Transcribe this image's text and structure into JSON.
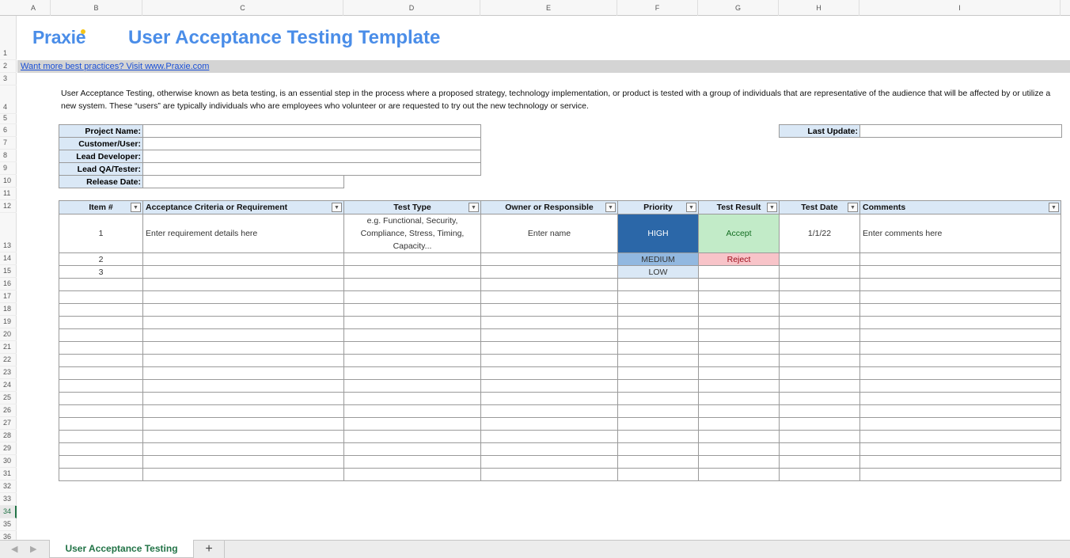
{
  "columns": [
    "A",
    "B",
    "C",
    "D",
    "E",
    "F",
    "G",
    "H",
    "I"
  ],
  "rows": [
    "1",
    "2",
    "3",
    "4",
    "5",
    "6",
    "7",
    "8",
    "9",
    "10",
    "11",
    "12",
    "13",
    "14",
    "15",
    "16",
    "17",
    "18",
    "19",
    "20",
    "21",
    "22",
    "23",
    "24",
    "25",
    "26",
    "27",
    "28",
    "29",
    "30",
    "31",
    "32",
    "33",
    "34",
    "35",
    "36"
  ],
  "active_row": "34",
  "header": {
    "logo": "Praxie",
    "title": "User Acceptance Testing Template",
    "link": "Want more best practices? Visit www.Praxie.com "
  },
  "description": "User Acceptance Testing, otherwise known as beta testing, is an essential step in the process where a proposed strategy, technology implementation, or product is tested with a group of individuals that are representative of the audience that will be affected by or utilize a new system. These “users” are typically individuals who are employees who volunteer or are requested to try out the new technology or service.",
  "project_info": {
    "project_name": {
      "label": "Project Name:",
      "value": ""
    },
    "customer_user": {
      "label": "Customer/User:",
      "value": ""
    },
    "lead_developer": {
      "label": "Lead Developer:",
      "value": ""
    },
    "lead_qa": {
      "label": "Lead QA/Tester:",
      "value": ""
    },
    "release_date": {
      "label": "Release Date:",
      "value": ""
    },
    "last_update": {
      "label": "Last Update:",
      "value": ""
    }
  },
  "table": {
    "headers": [
      "Item #",
      "Acceptance Criteria or Requirement",
      "Test Type",
      "Owner or Responsible",
      "Priority",
      "Test Result",
      "Test Date",
      "Comments"
    ],
    "rows": [
      [
        "1",
        "Enter requirement details here",
        "e.g. Functional, Security, Compliance, Stress, Timing, Capacity...",
        "Enter name",
        "HIGH",
        "Accept",
        "1/1/22",
        "Enter comments here"
      ],
      [
        "2",
        "",
        "",
        "",
        "MEDIUM",
        "Reject",
        "",
        ""
      ],
      [
        "3",
        "",
        "",
        "",
        "LOW",
        "",
        "",
        ""
      ]
    ],
    "empty_rows": 16
  },
  "colors": {
    "brand": "#4a8de8",
    "priority_high": "#2b67a8",
    "priority_medium": "#92b8e0",
    "priority_low": "#dae8f6",
    "accept": "#c2ebc8",
    "reject": "#f8c4c9",
    "sheet_tab": "#217346"
  },
  "sheet_tabs": [
    {
      "label": "User Acceptance Testing",
      "active": true
    }
  ],
  "add_sheet_label": "+"
}
